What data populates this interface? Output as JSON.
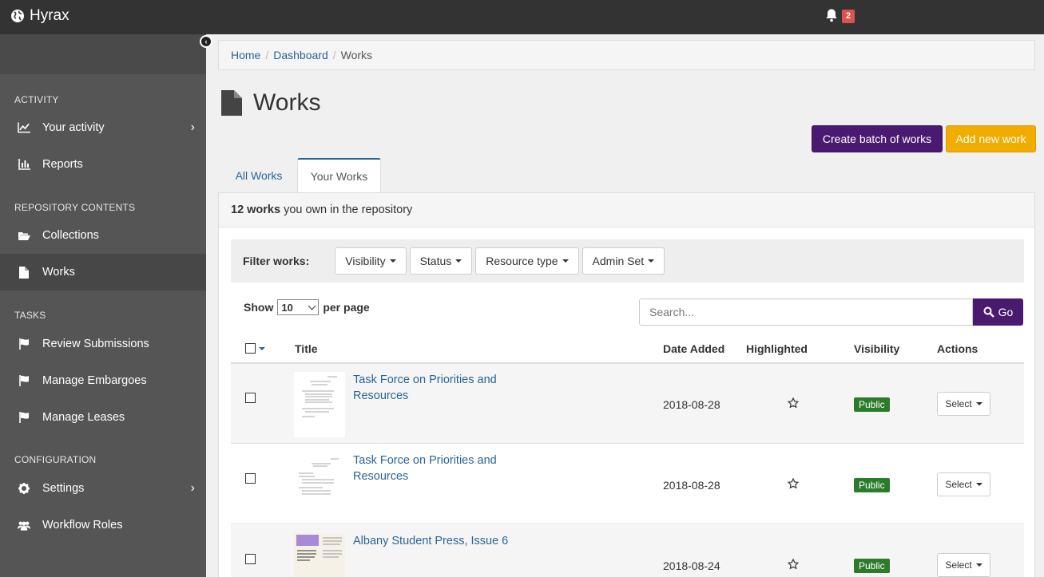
{
  "app": {
    "name": "Hyrax",
    "notification_count": "2"
  },
  "sidebar": {
    "sections": [
      {
        "label": "ACTIVITY"
      },
      {
        "label": "REPOSITORY CONTENTS"
      },
      {
        "label": "TASKS"
      },
      {
        "label": "CONFIGURATION"
      }
    ],
    "items": [
      {
        "label": "Your activity",
        "icon": "line-chart-icon",
        "has_submenu": true
      },
      {
        "label": "Reports",
        "icon": "bar-chart-icon"
      },
      {
        "label": "Collections",
        "icon": "folder-open-icon"
      },
      {
        "label": "Works",
        "icon": "file-icon",
        "active": true
      },
      {
        "label": "Review Submissions",
        "icon": "flag-icon"
      },
      {
        "label": "Manage Embargoes",
        "icon": "flag-icon"
      },
      {
        "label": "Manage Leases",
        "icon": "flag-icon"
      },
      {
        "label": "Settings",
        "icon": "gear-icon",
        "has_submenu": true
      },
      {
        "label": "Workflow Roles",
        "icon": "users-icon"
      }
    ]
  },
  "breadcrumb": {
    "home": "Home",
    "dashboard": "Dashboard",
    "current": "Works"
  },
  "page": {
    "title": "Works"
  },
  "actions": {
    "batch": "Create batch of works",
    "add": "Add new work"
  },
  "tabs": [
    {
      "label": "All Works"
    },
    {
      "label": "Your Works",
      "active": true
    }
  ],
  "summary": {
    "count": "12 works",
    "rest": "you own in the repository"
  },
  "filters": {
    "label": "Filter works:",
    "buttons": [
      "Visibility",
      "Status",
      "Resource type",
      "Admin Set"
    ]
  },
  "paging": {
    "show": "Show",
    "per_page_value": "10",
    "per_page": "per page"
  },
  "search": {
    "placeholder": "Search...",
    "button": "Go"
  },
  "table": {
    "headers": {
      "title": "Title",
      "date": "Date Added",
      "highlighted": "Highlighted",
      "visibility": "Visibility",
      "actions": "Actions"
    },
    "rows": [
      {
        "title": "Task Force on Priorities and Resources",
        "date": "2018-08-28",
        "visibility": "Public",
        "action": "Select"
      },
      {
        "title": "Task Force on Priorities and Resources",
        "date": "2018-08-28",
        "visibility": "Public",
        "action": "Select"
      },
      {
        "title": "Albany Student Press, Issue 6",
        "date": "2018-08-24",
        "visibility": "Public",
        "action": "Select"
      }
    ]
  },
  "colors": {
    "accent": "#4a1a70",
    "add": "#f0ad00",
    "link": "#2a6496",
    "public": "#2c7a2c"
  }
}
